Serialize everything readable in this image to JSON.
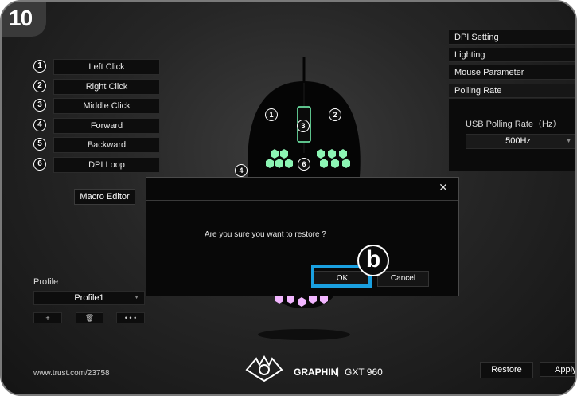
{
  "step": {
    "number": "10"
  },
  "button_assignments": [
    {
      "num": "1",
      "label": "Left Click"
    },
    {
      "num": "2",
      "label": "Right Click"
    },
    {
      "num": "3",
      "label": "Middle Click"
    },
    {
      "num": "4",
      "label": "Forward"
    },
    {
      "num": "5",
      "label": "Backward"
    },
    {
      "num": "6",
      "label": "DPI Loop"
    }
  ],
  "macro_editor_label": "Macro Editor",
  "profile": {
    "label": "Profile",
    "selected": "Profile1",
    "add_label": "+",
    "delete_label": "🗑",
    "more_label": "• • •"
  },
  "url": "www.trust.com/23758",
  "menu": [
    "DPI Setting",
    "Lighting",
    "Mouse Parameter",
    "Polling Rate"
  ],
  "polling": {
    "label": "USB Polling Rate（Hz）",
    "value": "500Hz"
  },
  "restore_label": "Restore",
  "apply_label": "Apply",
  "brand": {
    "name": "GRAPHIN",
    "separator": "|",
    "model": "GXT 960"
  },
  "mouse_labels": [
    "1",
    "2",
    "3",
    "4",
    "6"
  ],
  "dialog": {
    "close": "✕",
    "message": "Are you sure you want to restore ?",
    "ok": "OK",
    "cancel": "Cancel"
  },
  "callout_letter": "b",
  "colors": {
    "highlight": "#1aa0e0",
    "led_green": "#8cf5b4",
    "led_pink": "#f2b6ff"
  }
}
